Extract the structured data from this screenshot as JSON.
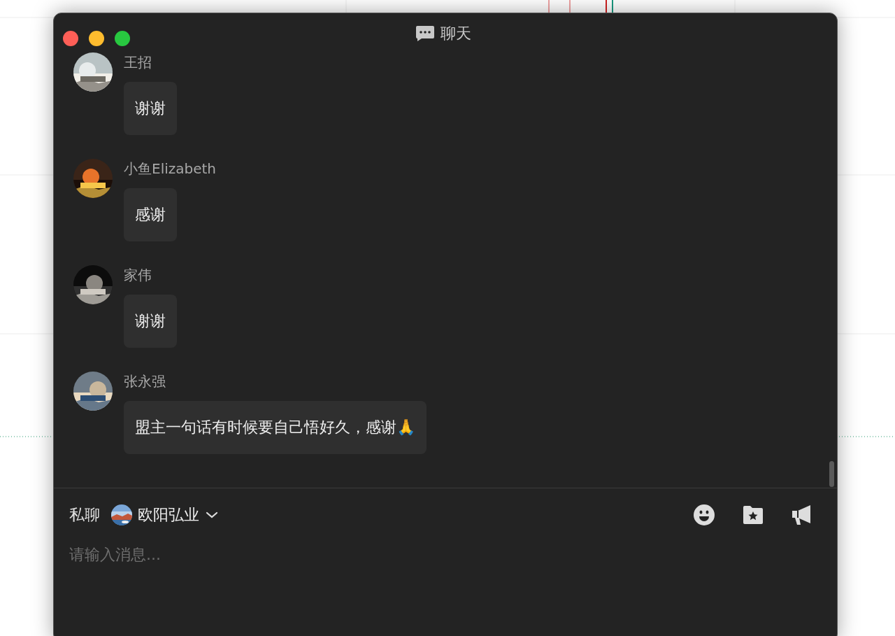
{
  "window": {
    "title": "聊天"
  },
  "messages": [
    {
      "sender": "王招",
      "text": "谢谢"
    },
    {
      "sender": "小鱼Elizabeth",
      "text": "感谢"
    },
    {
      "sender": "家伟",
      "text": "谢谢"
    },
    {
      "sender": "张永强",
      "text": "盟主一句话有时候要自己悟好久，感谢🙏"
    }
  ],
  "composer": {
    "mode": "私聊",
    "recipient": "欧阳弘业",
    "placeholder": "请输入消息..."
  }
}
